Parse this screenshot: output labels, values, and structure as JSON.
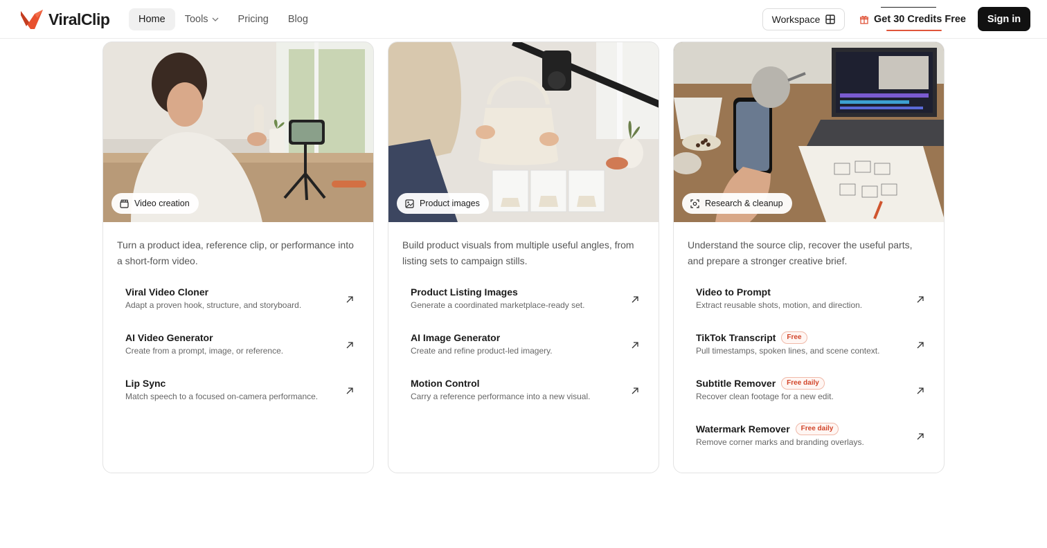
{
  "brand": {
    "name": "ViralClip",
    "accent": "#e8502e"
  },
  "nav": {
    "items": [
      {
        "label": "Home",
        "active": true
      },
      {
        "label": "Tools",
        "dropdown": true
      },
      {
        "label": "Pricing"
      },
      {
        "label": "Blog"
      }
    ]
  },
  "header": {
    "workspace_label": "Workspace",
    "credits_label": "Get 30 Credits Free",
    "signin_label": "Sign in"
  },
  "cards": [
    {
      "badge": "Video creation",
      "badge_icon": "clapperboard-icon",
      "description": "Turn a product idea, reference clip, or performance into a short-form video.",
      "items": [
        {
          "title": "Viral Video Cloner",
          "subtitle": "Adapt a proven hook, structure, and storyboard."
        },
        {
          "title": "AI Video Generator",
          "subtitle": "Create from a prompt, image, or reference."
        },
        {
          "title": "Lip Sync",
          "subtitle": "Match speech to a focused on-camera performance."
        }
      ]
    },
    {
      "badge": "Product images",
      "badge_icon": "image-icon",
      "description": "Build product visuals from multiple useful angles, from listing sets to campaign stills.",
      "items": [
        {
          "title": "Product Listing Images",
          "subtitle": "Generate a coordinated marketplace-ready set."
        },
        {
          "title": "AI Image Generator",
          "subtitle": "Create and refine product-led imagery."
        },
        {
          "title": "Motion Control",
          "subtitle": "Carry a reference performance into a new visual."
        }
      ]
    },
    {
      "badge": "Research & cleanup",
      "badge_icon": "scan-icon",
      "description": "Understand the source clip, recover the useful parts, and prepare a stronger creative brief.",
      "items": [
        {
          "title": "Video to Prompt",
          "subtitle": "Extract reusable shots, motion, and direction."
        },
        {
          "title": "TikTok Transcript",
          "tag": "Free",
          "subtitle": "Pull timestamps, spoken lines, and scene context."
        },
        {
          "title": "Subtitle Remover",
          "tag": "Free daily",
          "subtitle": "Recover clean footage for a new edit."
        },
        {
          "title": "Watermark Remover",
          "tag": "Free daily",
          "subtitle": "Remove corner marks and branding overlays."
        }
      ]
    }
  ]
}
